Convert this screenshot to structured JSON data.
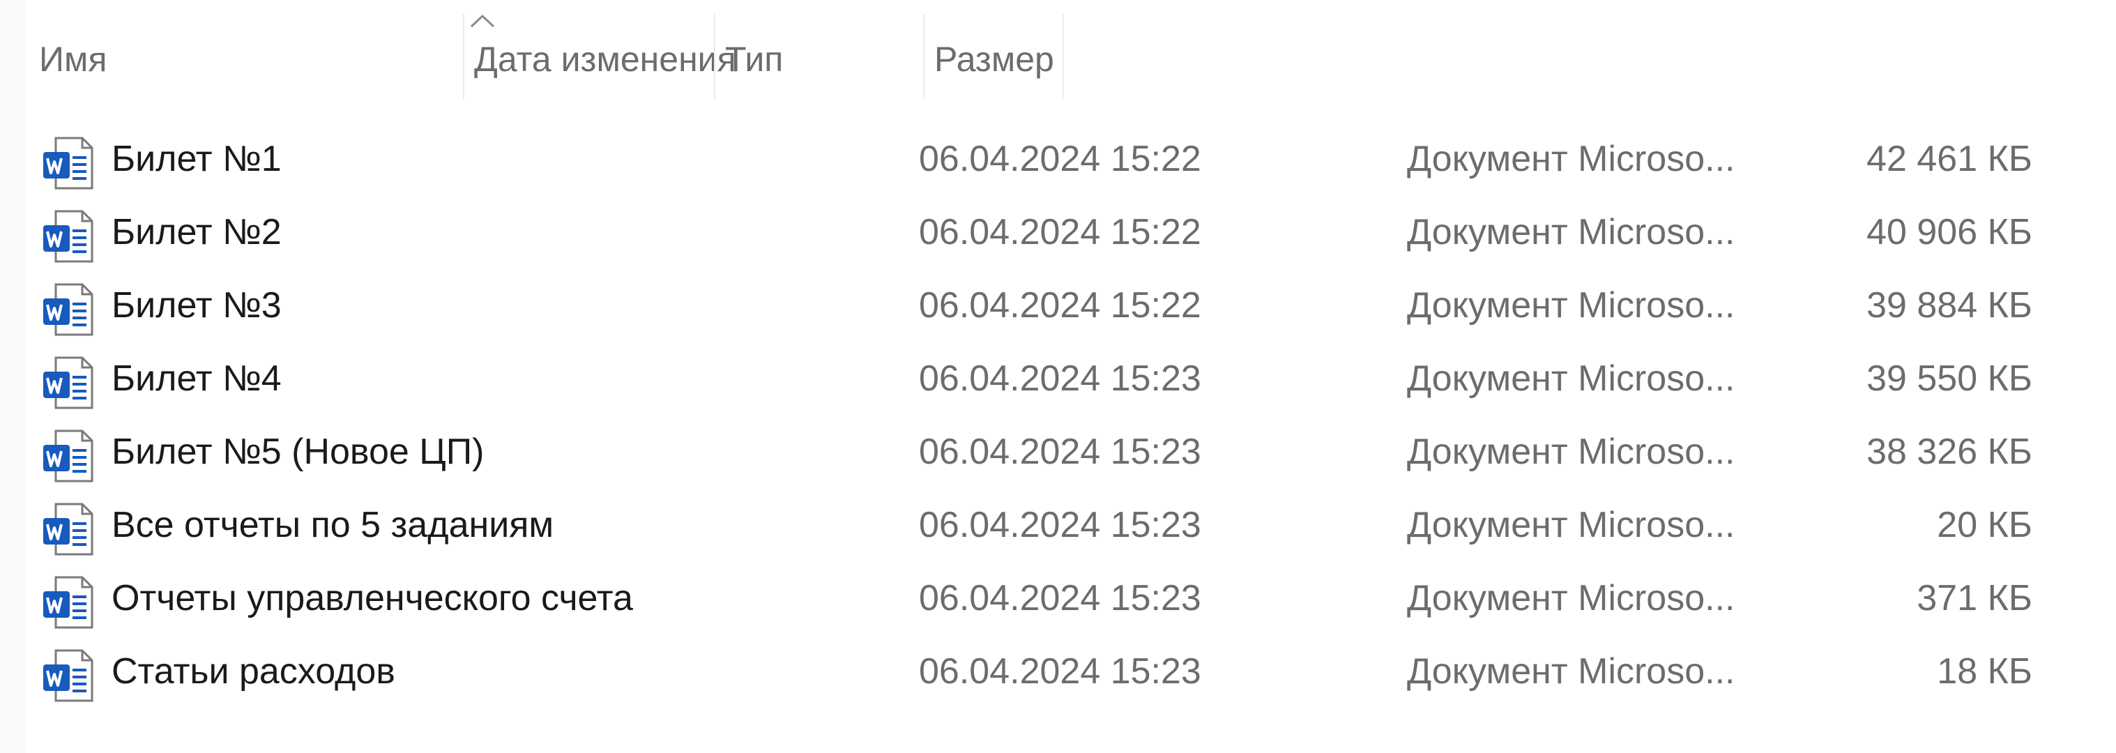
{
  "columns": {
    "name": "Имя",
    "date": "Дата изменения",
    "type": "Тип",
    "size": "Размер"
  },
  "sort": {
    "column": "name",
    "direction": "ascending",
    "icon": "chevron-up-icon"
  },
  "file_icon": "word-document-icon",
  "files": [
    {
      "name": "Билет №1",
      "date": "06.04.2024 15:22",
      "type": "Документ Microso...",
      "size": "42 461 КБ"
    },
    {
      "name": "Билет №2",
      "date": "06.04.2024 15:22",
      "type": "Документ Microso...",
      "size": "40 906 КБ"
    },
    {
      "name": "Билет №3",
      "date": "06.04.2024 15:22",
      "type": "Документ Microso...",
      "size": "39 884 КБ"
    },
    {
      "name": "Билет №4",
      "date": "06.04.2024 15:23",
      "type": "Документ Microso...",
      "size": "39 550 КБ"
    },
    {
      "name": "Билет №5 (Новое ЦП)",
      "date": "06.04.2024 15:23",
      "type": "Документ Microso...",
      "size": "38 326 КБ"
    },
    {
      "name": "Все отчеты по 5 заданиям",
      "date": "06.04.2024 15:23",
      "type": "Документ Microso...",
      "size": "20 КБ"
    },
    {
      "name": "Отчеты управленческого счета",
      "date": "06.04.2024 15:23",
      "type": "Документ Microso...",
      "size": "371 КБ"
    },
    {
      "name": "Статьи расходов",
      "date": "06.04.2024 15:23",
      "type": "Документ Microso...",
      "size": "18 КБ"
    }
  ],
  "colors": {
    "header_text": "#6c6c6c",
    "name_text": "#1a1a1a",
    "meta_text": "#6c6c6c",
    "word_blue": "#185abd"
  }
}
